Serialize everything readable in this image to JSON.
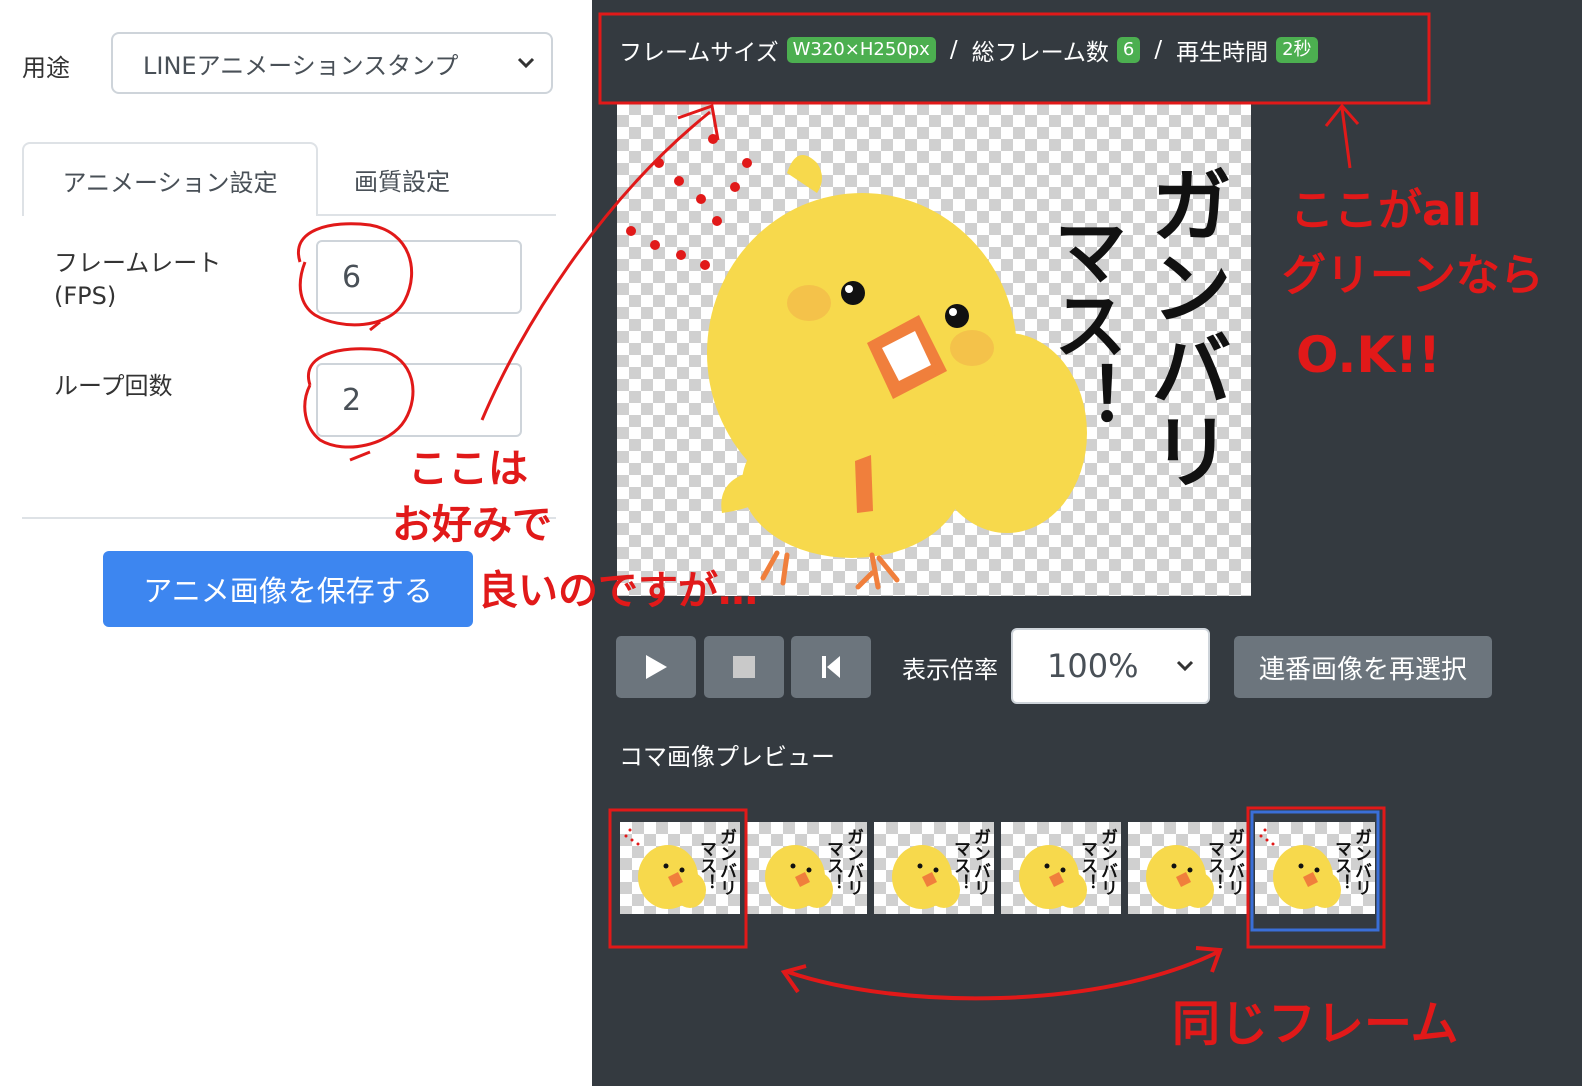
{
  "left_panel": {
    "usage_label": "用途",
    "usage_select_value": "LINEアニメーションスタンプ",
    "tabs": [
      {
        "label": "アニメーション設定",
        "active": true
      },
      {
        "label": "画質設定",
        "active": false
      }
    ],
    "fps_label_line1": "フレームレート",
    "fps_label_line2": "(FPS)",
    "fps_value": "6",
    "loop_label": "ループ回数",
    "loop_value": "2",
    "save_button": "アニメ画像を保存する"
  },
  "right_panel": {
    "info": {
      "frame_size_label": "フレームサイズ",
      "frame_size_badge": "W320×H250px",
      "total_frames_label": "総フレーム数",
      "total_frames_badge": "6",
      "playback_label": "再生時間",
      "playback_badge": "2秒",
      "separator": "/"
    },
    "preview_image_text": {
      "line1": "ガンバリ",
      "line2": "マス！"
    },
    "controls": {
      "zoom_label": "表示倍率",
      "zoom_value": "100%",
      "reselect_button": "連番画像を再選択"
    },
    "frame_preview_title": "コマ画像プレビュー",
    "frame_count": 6,
    "selected_frame": 6
  },
  "annotations": {
    "note_right_line1": "ここがall",
    "note_right_line2": "グリーンなら",
    "note_right_line3": "O.K!!",
    "note_left_line1": "ここは",
    "note_left_line2": "お好みで",
    "note_left_line3": "良いのですが…",
    "note_bottom": "同じフレーム"
  },
  "colors": {
    "dark_panel": "#343a40",
    "primary": "#3d86f0",
    "badge_green": "#4caf50",
    "annotation_red": "#e11919",
    "secondary_button": "#6c757d"
  }
}
